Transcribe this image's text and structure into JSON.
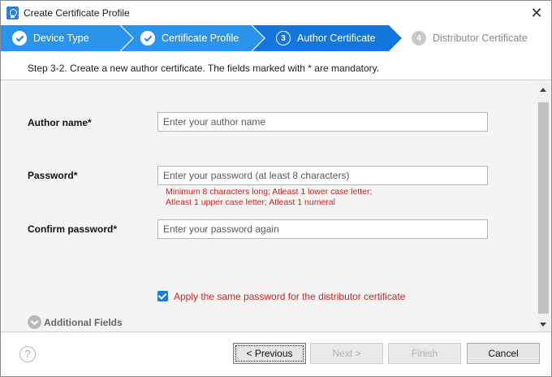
{
  "window": {
    "title": "Create Certificate Profile"
  },
  "steps": [
    {
      "label": "Device Type",
      "state": "done",
      "number": ""
    },
    {
      "label": "Certificate Profile",
      "state": "done",
      "number": ""
    },
    {
      "label": "Author Certificate",
      "state": "active",
      "number": "3"
    },
    {
      "label": "Distributor Certificate",
      "state": "todo",
      "number": "4"
    }
  ],
  "subtitle": "Step 3-2. Create a new author certificate. The fields marked with * are mandatory.",
  "form": {
    "author_name": {
      "label": "Author name*",
      "value": "",
      "placeholder": "Enter your author name"
    },
    "password": {
      "label": "Password*",
      "value": "",
      "placeholder": "Enter your password (at least 8 characters)",
      "hint_line1": "Minimum 8 characters long; Atleast 1 lower case letter;",
      "hint_line2": "Atleast 1 upper case letter; Atleast 1 numeral"
    },
    "confirm_password": {
      "label": "Confirm password*",
      "value": "",
      "placeholder": "Enter your password again"
    },
    "apply_same": {
      "label": "Apply the same password for the distributor certificate",
      "checked": true
    },
    "additional_fields": {
      "label": "Additional Fields"
    }
  },
  "buttons": {
    "help": "?",
    "previous": "< Previous",
    "next": "Next >",
    "finish": "Finish",
    "cancel": "Cancel"
  },
  "colors": {
    "accent": "#1e8ae8",
    "step_done": "#2a93ea",
    "step_active": "#1276dc",
    "step_todo": "#e6e6e6",
    "error": "#d42020"
  }
}
